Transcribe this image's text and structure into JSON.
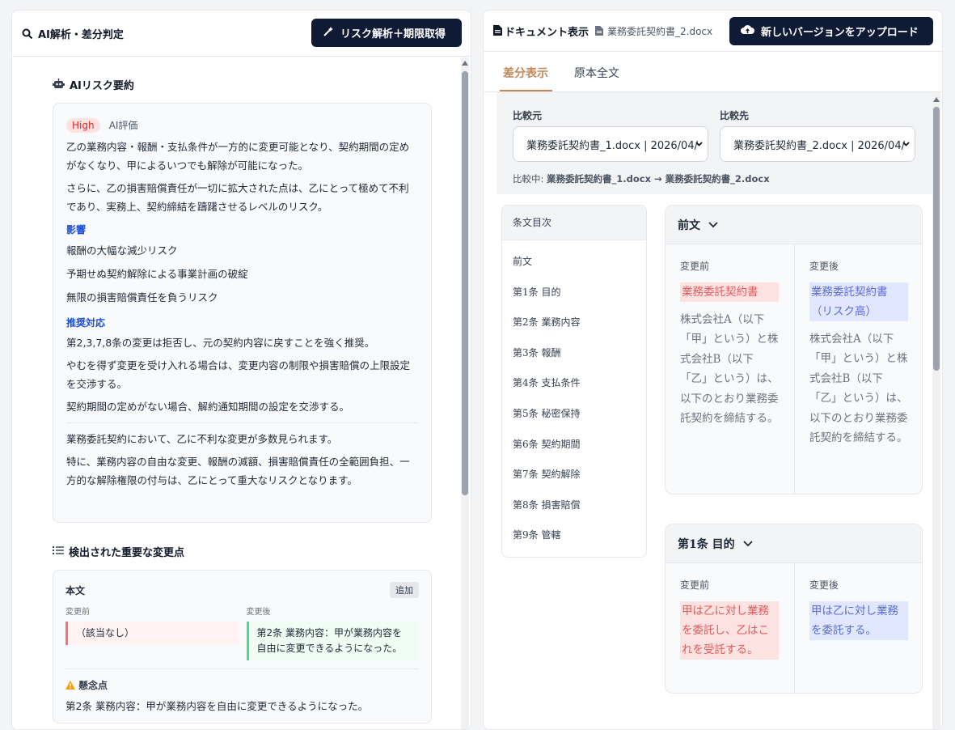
{
  "left": {
    "title": "AI解析・差分判定",
    "analyze_button": "リスク解析＋期限取得",
    "summary_title": "AIリスク要約",
    "risk_level": "High",
    "risk_eval_label": "AI評価",
    "summary_paragraphs": [
      "乙の業務内容・報酬・支払条件が一方的に変更可能となり、契約期間の定めがなくなり、甲によるいつでも解除が可能になった。",
      "さらに、乙の損害賠償責任が一切に拡大された点は、乙にとって極めて不利であり、実務上、契約締結を躊躇させるレベルのリスク。"
    ],
    "impact_title": "影響",
    "impacts": [
      "報酬の大幅な減少リスク",
      "予期せぬ契約解除による事業計画の破綻",
      "無限の損害賠償責任を負うリスク"
    ],
    "recommend_title": "推奨対応",
    "recommendations": [
      "第2,3,7,8条の変更は拒否し、元の契約内容に戻すことを強く推奨。",
      "やむを得ず変更を受け入れる場合は、変更内容の制限や損害賠償の上限設定を交渉する。",
      "契約期間の定めがない場合、解約通知期間の設定を交渉する。"
    ],
    "overall": [
      "業務委託契約において、乙に不利な変更が多数見られます。",
      "特に、業務内容の自由な変更、報酬の減額、損害賠償責任の全範囲負担、一方的な解除権限の付与は、乙にとって重大なリスクとなります。"
    ],
    "changes_title": "検出された重要な変更点",
    "change": {
      "section": "本文",
      "tag": "追加",
      "before_label": "変更前",
      "after_label": "変更後",
      "before": "（該当なし）",
      "after": "第2条 業務内容：甲が業務内容を自由に変更できるようになった。",
      "concern_title": "懸念点",
      "concern": "第2条 業務内容：甲が業務内容を自由に変更できるようになった。"
    }
  },
  "right": {
    "title": "ドキュメント表示",
    "filename": "業務委託契約書_2.docx",
    "upload_button": "新しいバージョンをアップロード",
    "tabs": [
      "差分表示",
      "原本全文"
    ],
    "compare_from_label": "比較元",
    "compare_to_label": "比較先",
    "compare_from_value": "業務委託契約書_1.docx | 2026/04/",
    "compare_to_value": "業務委託契約書_2.docx | 2026/04/",
    "comparing_prefix": "比較中:",
    "comparing_value": "業務委託契約書_1.docx → 業務委託契約書_2.docx",
    "toc_title": "条文目次",
    "toc": [
      "前文",
      "第1条 目的",
      "第2条 業務内容",
      "第3条 報酬",
      "第4条 支払条件",
      "第5条 秘密保持",
      "第6条 契約期間",
      "第7条 契約解除",
      "第8条 損害賠償",
      "第9条 管轄"
    ],
    "articles": [
      {
        "title": "前文",
        "before_label": "変更前",
        "after_label": "変更後",
        "before_mark": "業務委託契約書",
        "after_mark": "業務委託契約書（リスク高）",
        "before_text": "株式会社A（以下「甲」という）と株式会社B（以下「乙」という）は、以下のとおり業務委託契約を締結する。",
        "after_text": "株式会社A（以下「甲」という）と株式会社B（以下「乙」という）は、以下のとおり業務委託契約を締結する。"
      },
      {
        "title": "第1条 目的",
        "before_label": "変更前",
        "after_label": "変更後",
        "before_mark": "甲は乙に対し業務を委託し、乙はこれを受託する。",
        "after_mark": "甲は乙に対し業務を委託する。"
      }
    ]
  }
}
